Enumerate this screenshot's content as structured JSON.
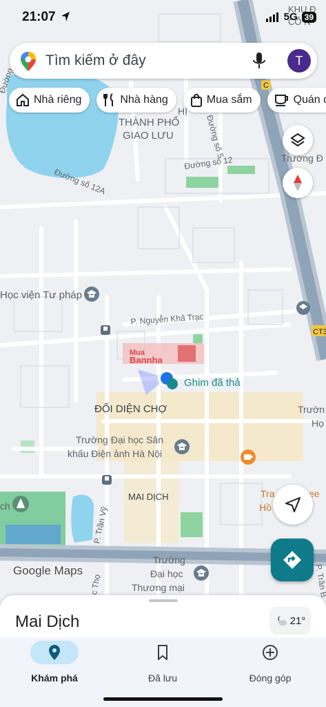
{
  "status_bar": {
    "time": "21:07",
    "network": "5G",
    "battery": "39"
  },
  "search": {
    "placeholder": "Tìm kiếm ở đây",
    "avatar_initial": "T"
  },
  "chips": [
    {
      "label": "Nhà riêng",
      "icon": "home-icon"
    },
    {
      "label": "Nhà hàng",
      "icon": "restaurant-icon"
    },
    {
      "label": "Mua sắm",
      "icon": "shopping-bag-icon"
    },
    {
      "label": "Quán c",
      "icon": "coffee-icon"
    }
  ],
  "map": {
    "labels": {
      "khu_do_line1": "KHU Đ",
      "khu_do_line2": "CỔ N",
      "thanh_pho_line1": "THÀNH PHỐ",
      "thanh_pho_line2": "GIAO LƯU",
      "pho_thanh_pho_fragment": "HỊ",
      "duong_so_12": "Đường số 12",
      "duong_so_12a": "Đường số 12A",
      "duong_so_5": "Đường số 5",
      "duong_left": "Đường",
      "truong_d": "Trường Đ",
      "hoc_vien_tu_phap": "Học viện Tư pháp",
      "p_nguyen_kha_trac": "P. Nguyễn Khả Trạc",
      "ghim_da_tha": "Ghim đã thả",
      "doi_dien_cho": "ĐỐI DIỆN CHỢ",
      "truong_dh_san_khau_line1": "Trường Đại học Sân",
      "truong_dh_san_khau_line2": "khấu Điện ảnh Hà Nội",
      "mai_dich_area": "MAI DỊCH",
      "p_tran_vy": "P. Trần Vỹ",
      "truong_dh_thuong_mai_line1": "Trường",
      "truong_dh_thuong_mai_line2": "Đại học",
      "truong_dh_thuong_mai_line3": "Thương mại",
      "tra_fragment": "Tra",
      "ho_fragment": "Hồ",
      "ee_fragment": "ee",
      "truong_h_right": "Trườn",
      "h_right": "Họ",
      "ch_left": "ch",
      "c_tho": "c Thọ",
      "p_tran_b": "P. Trần B",
      "ct3_badge": "CT3",
      "c_badge": "C",
      "watermark_line1": "Mua",
      "watermark_line2": "Bannha"
    }
  },
  "attribution": "Google Maps",
  "bottom_sheet": {
    "title": "Mai Dịch",
    "temperature": "21°"
  },
  "bottom_nav": [
    {
      "label": "Khám phá",
      "icon": "explore-pin-icon",
      "active": true
    },
    {
      "label": "Đã lưu",
      "icon": "bookmark-icon",
      "active": false
    },
    {
      "label": "Đóng góp",
      "icon": "add-circle-icon",
      "active": false
    }
  ]
}
